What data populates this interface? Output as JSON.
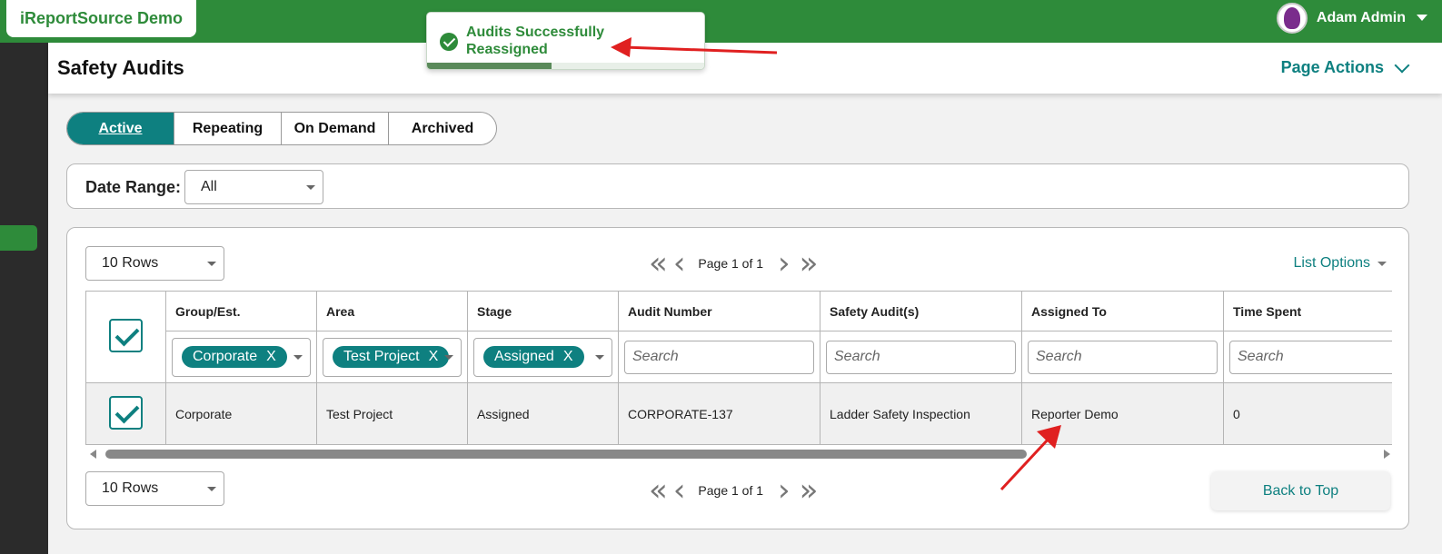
{
  "app": {
    "brand": "iReportSource Demo",
    "user_name": "Adam Admin"
  },
  "header": {
    "title": "Safety Audits",
    "page_actions": "Page Actions"
  },
  "toast": {
    "message": "Audits Successfully Reassigned",
    "progress": 0.45
  },
  "tabs": [
    {
      "label": "Active",
      "active": true
    },
    {
      "label": "Repeating",
      "active": false
    },
    {
      "label": "On Demand",
      "active": false
    },
    {
      "label": "Archived",
      "active": false
    }
  ],
  "filters": {
    "date_range_label": "Date Range:",
    "date_range_value": "All"
  },
  "list": {
    "rows_select": "10 Rows",
    "page_info": "Page 1 of 1",
    "list_options": "List Options",
    "back_to_top": "Back to Top",
    "columns": [
      "Group/Est.",
      "Area",
      "Stage",
      "Audit Number",
      "Safety Audit(s)",
      "Assigned To",
      "Time Spent"
    ],
    "column_filters": {
      "group": "Corporate",
      "area": "Test Project",
      "stage": "Assigned",
      "search_placeholder": "Search"
    },
    "rows": [
      {
        "group": "Corporate",
        "area": "Test Project",
        "stage": "Assigned",
        "audit_number": "CORPORATE-137",
        "safety_audit": "Ladder Safety Inspection",
        "assigned_to": "Reporter Demo",
        "time_spent": "0"
      }
    ]
  },
  "colors": {
    "brand_green": "#2e8b3a",
    "teal": "#0e8080",
    "sidebar": "#2b2b2b",
    "annotation_red": "#e02020"
  },
  "icons": [
    "check-circle-icon",
    "chevron-down-icon",
    "first-page-icon",
    "prev-page-icon",
    "next-page-icon",
    "last-page-icon",
    "checkbox-checked-icon"
  ]
}
